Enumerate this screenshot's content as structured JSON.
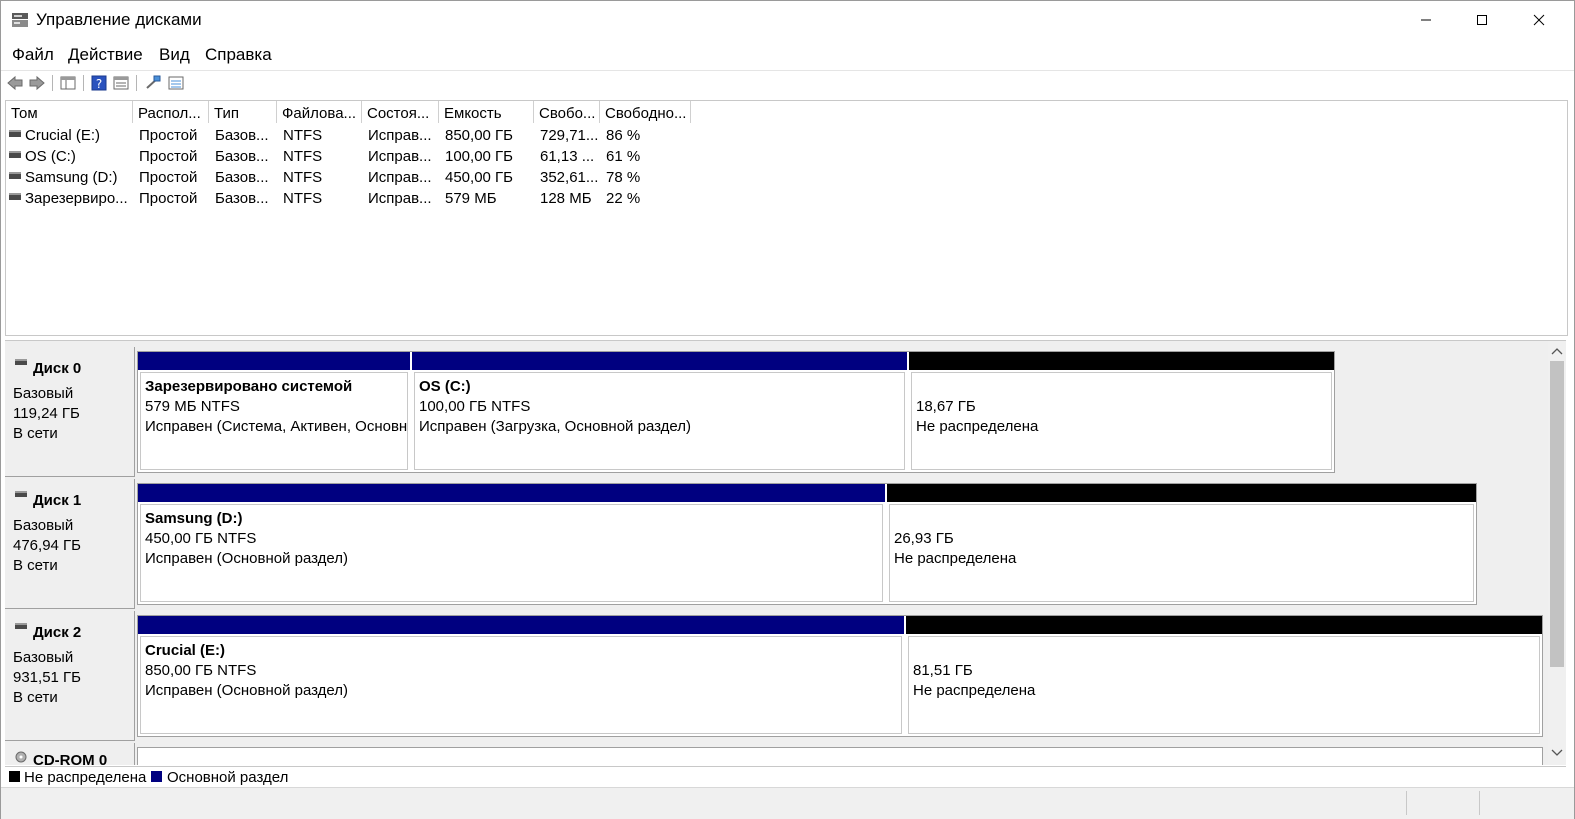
{
  "window": {
    "title": "Управление дисками"
  },
  "menu": [
    "Файл",
    "Действие",
    "Вид",
    "Справка"
  ],
  "toolbar": {
    "icons": [
      "back-arrow-icon",
      "forward-arrow-icon",
      "view-icon",
      "help-icon",
      "properties-icon",
      "connect-icon",
      "list-view-icon"
    ]
  },
  "list": {
    "columns": [
      "Том",
      "Распол...",
      "Тип",
      "Файлова...",
      "Состоя...",
      "Емкость",
      "Свобо...",
      "Свободно..."
    ],
    "rows": [
      [
        "Crucial (E:)",
        "Простой",
        "Базов...",
        "NTFS",
        "Исправ...",
        "850,00 ГБ",
        "729,71...",
        "86 %"
      ],
      [
        "OS (C:)",
        "Простой",
        "Базов...",
        "NTFS",
        "Исправ...",
        "100,00 ГБ",
        "61,13 ...",
        "61 %"
      ],
      [
        "Samsung (D:)",
        "Простой",
        "Базов...",
        "NTFS",
        "Исправ...",
        "450,00 ГБ",
        "352,61...",
        "78 %"
      ],
      [
        "Зарезервиро...",
        "Простой",
        "Базов...",
        "NTFS",
        "Исправ...",
        "579 МБ",
        "128 МБ",
        "22 %"
      ]
    ]
  },
  "disks": [
    {
      "name": "Диск 0",
      "type": "Базовый",
      "size": "119,24 ГБ",
      "status": "В сети",
      "partitions": [
        {
          "kind": "primary",
          "title": "Зарезервировано системой",
          "line1": "579 МБ NTFS",
          "line2": "Исправен (Система, Активен, Основн"
        },
        {
          "kind": "primary",
          "title": "OS  (C:)",
          "line1": "100,00 ГБ NTFS",
          "line2": "Исправен (Загрузка, Основной раздел)"
        },
        {
          "kind": "unallocated",
          "title": "",
          "line1": "18,67 ГБ",
          "line2": "Не распределена"
        }
      ]
    },
    {
      "name": "Диск 1",
      "type": "Базовый",
      "size": "476,94 ГБ",
      "status": "В сети",
      "partitions": [
        {
          "kind": "primary",
          "title": "Samsung  (D:)",
          "line1": "450,00 ГБ NTFS",
          "line2": "Исправен (Основной раздел)"
        },
        {
          "kind": "unallocated",
          "title": "",
          "line1": "26,93 ГБ",
          "line2": "Не распределена"
        }
      ]
    },
    {
      "name": "Диск 2",
      "type": "Базовый",
      "size": "931,51 ГБ",
      "status": "В сети",
      "partitions": [
        {
          "kind": "primary",
          "title": "Crucial  (E:)",
          "line1": "850,00 ГБ NTFS",
          "line2": "Исправен (Основной раздел)"
        },
        {
          "kind": "unallocated",
          "title": "",
          "line1": "81,51 ГБ",
          "line2": "Не распределена"
        }
      ]
    }
  ],
  "cdrom": {
    "name": "CD-ROM 0"
  },
  "legend": [
    {
      "label": "Не распределена",
      "color": "#000000"
    },
    {
      "label": "Основной раздел",
      "color": "#000080"
    }
  ],
  "colors": {
    "primary": "#000080",
    "unallocated": "#000000"
  }
}
